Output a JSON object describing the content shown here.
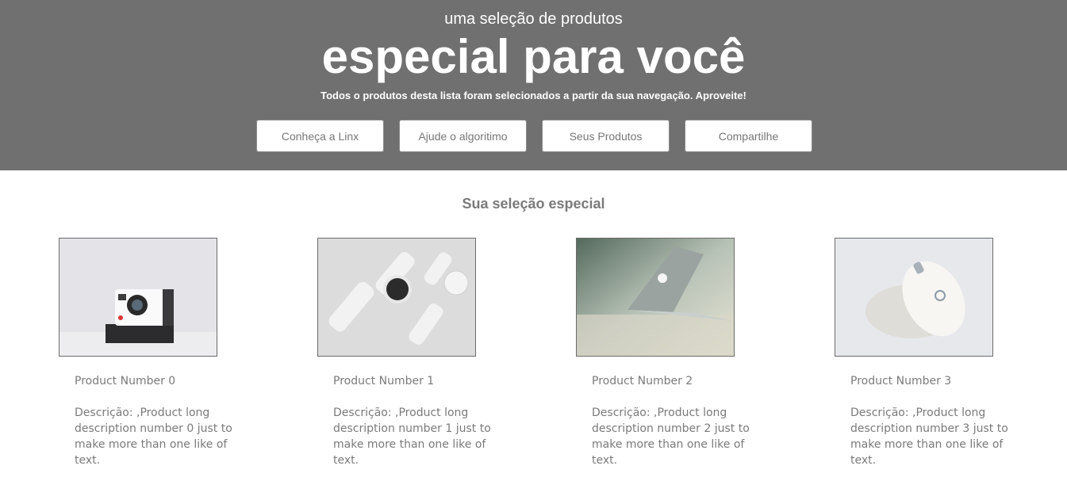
{
  "hero": {
    "pre_title": "uma seleção de produtos",
    "title": "especial para você",
    "subtitle": "Todos o produtos desta lista foram selecionados a partir da sua navegação. Aproveite!",
    "buttons": [
      {
        "label": "Conheça a Linx"
      },
      {
        "label": "Ajude o algoritimo"
      },
      {
        "label": "Seus Produtos"
      },
      {
        "label": "Compartilhe"
      }
    ],
    "background_color": "#707070"
  },
  "section": {
    "title": "Sua seleção especial"
  },
  "products": [
    {
      "name": "Product Number 0",
      "description": "Descrição: ,Product long description number 0 just to make more than one like of text.",
      "image_icon": "instant-camera-icon"
    },
    {
      "name": "Product Number 1",
      "description": "Descrição: ,Product long description number 1 just to make more than one like of text.",
      "image_icon": "smartwatch-icon"
    },
    {
      "name": "Product Number 2",
      "description": "Descrição: ,Product long description number 2 just to make more than one like of text.",
      "image_icon": "laptop-icon"
    },
    {
      "name": "Product Number 3",
      "description": "Descrição: ,Product long description number 3 just to make more than one like of text.",
      "image_icon": "mouse-icon"
    }
  ]
}
